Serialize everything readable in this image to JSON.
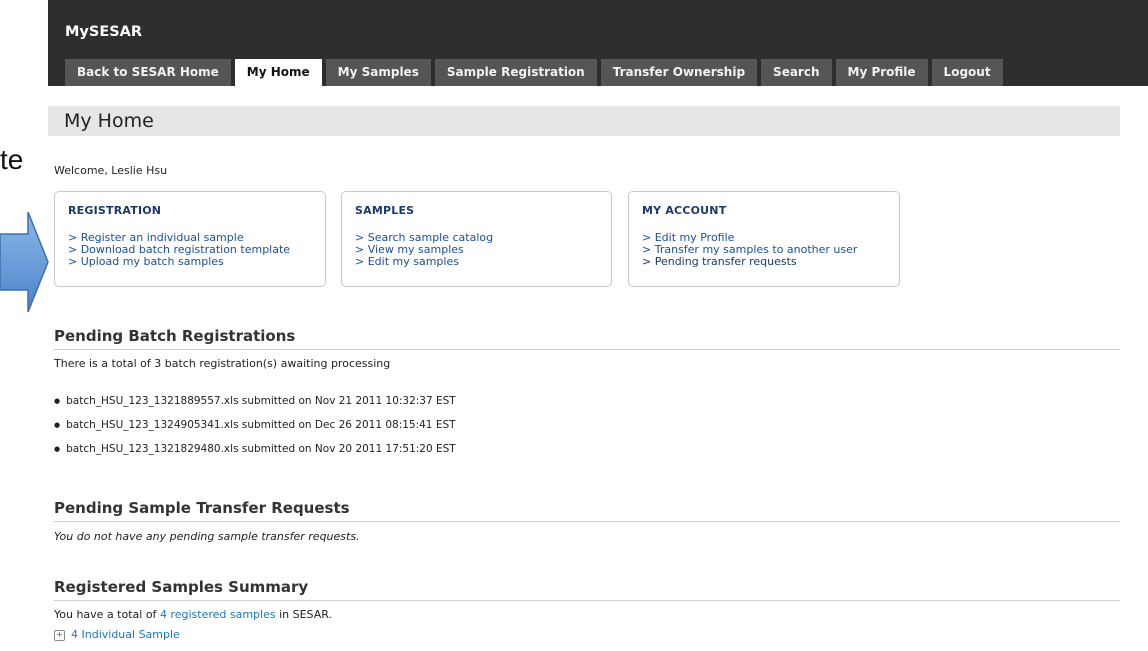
{
  "slide": {
    "fragment_text": "te"
  },
  "app": {
    "brand": "MySESAR"
  },
  "nav": {
    "tabs": [
      {
        "label": "Back to SESAR Home",
        "active": false
      },
      {
        "label": "My Home",
        "active": true
      },
      {
        "label": "My Samples",
        "active": false
      },
      {
        "label": "Sample Registration",
        "active": false
      },
      {
        "label": "Transfer Ownership",
        "active": false
      },
      {
        "label": "Search",
        "active": false
      },
      {
        "label": "My Profile",
        "active": false
      },
      {
        "label": "Logout",
        "active": false
      }
    ]
  },
  "page": {
    "title": "My Home",
    "welcome": "Welcome, Leslie Hsu"
  },
  "boxes": {
    "registration": {
      "title": "REGISTRATION",
      "links": [
        "> Register an individual sample",
        "> Download batch registration template",
        "> Upload my batch samples"
      ]
    },
    "samples": {
      "title": "SAMPLES",
      "links": [
        "> Search sample catalog",
        "> View my samples",
        "> Edit my samples"
      ]
    },
    "account": {
      "title": "MY ACCOUNT",
      "links": [
        "> Edit my Profile",
        "> Transfer my samples to another user",
        "> Pending transfer requests"
      ]
    }
  },
  "pending_batch": {
    "title": "Pending Batch Registrations",
    "summary": "There is a total of 3 batch registration(s) awaiting processing",
    "items": [
      "batch_HSU_123_1321889557.xls submitted on Nov 21 2011 10:32:37 EST",
      "batch_HSU_123_1324905341.xls submitted on Dec 26 2011 08:15:41 EST",
      "batch_HSU_123_1321829480.xls submitted on Nov 20 2011 17:51:20 EST"
    ]
  },
  "pending_transfer": {
    "title": "Pending Sample Transfer Requests",
    "message": "You do not have any pending sample transfer requests."
  },
  "registered_summary": {
    "title": "Registered Samples Summary",
    "text_before": "You have a total of ",
    "link_text": "4 registered samples",
    "text_after": " in SESAR.",
    "expand_label": "4 Individual Sample"
  },
  "colors": {
    "header": "#2e2e2e",
    "tab": "#555555",
    "link": "#1c76c0",
    "arrow": "#5b95d5"
  },
  "icons": {
    "slide_arrow": "right-arrow-icon",
    "expand": "expand-toggle-icon"
  }
}
